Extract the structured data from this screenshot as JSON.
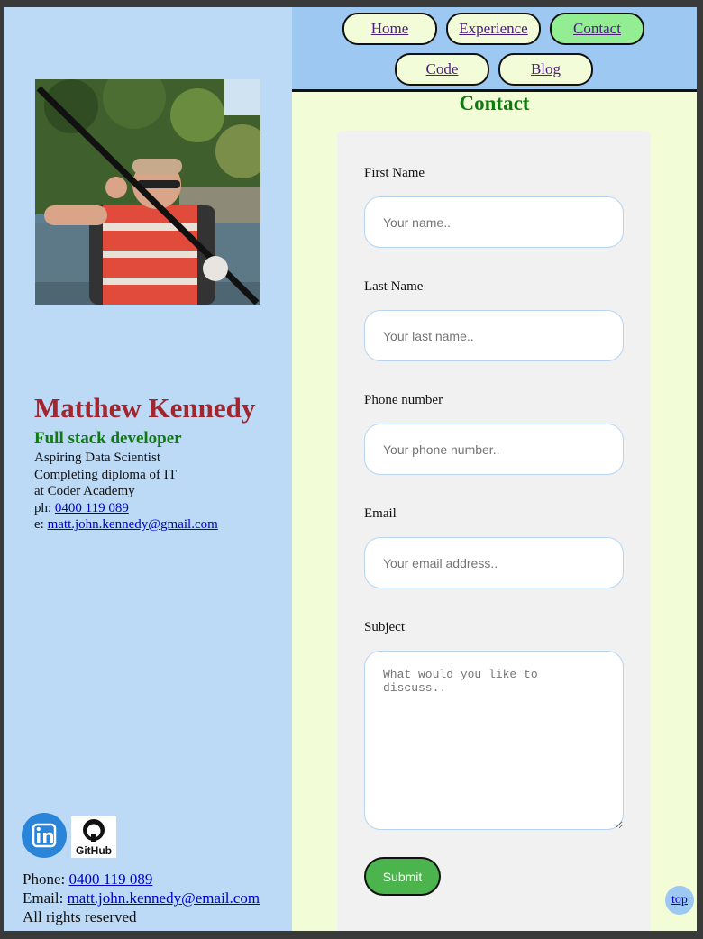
{
  "profile": {
    "name": "Matthew Kennedy",
    "role": "Full stack developer",
    "bio_lines": [
      "Aspiring Data Scientist",
      "Completing diploma of IT",
      "at Coder Academy"
    ],
    "phone_prefix": "ph: ",
    "phone": "0400 119 089",
    "email_prefix": "e: ",
    "email": "matt.john.kennedy@gmail.com"
  },
  "social": {
    "linkedin_icon": "linkedin-icon",
    "github_icon": "github-icon",
    "github_text": "GitHub"
  },
  "footer": {
    "phone_label": "Phone: ",
    "phone": "0400 119 089",
    "email_label": "Email: ",
    "email": "matt.john.kennedy@email.com",
    "rights": "All rights reserved"
  },
  "nav": {
    "items": [
      {
        "label": "Home"
      },
      {
        "label": "Experience"
      },
      {
        "label": "Contact",
        "active": true
      },
      {
        "label": "Code"
      },
      {
        "label": "Blog"
      }
    ]
  },
  "contact": {
    "title": "Contact",
    "first_name_label": "First Name",
    "first_name_placeholder": "Your name..",
    "last_name_label": "Last Name",
    "last_name_placeholder": "Your last name..",
    "phone_label": "Phone number",
    "phone_placeholder": "Your phone number..",
    "email_label": "Email",
    "email_placeholder": "Your email address..",
    "subject_label": "Subject",
    "subject_placeholder": "What would you like to discuss..",
    "submit_label": "Submit"
  },
  "top_link": "top",
  "colors": {
    "sidebar_bg": "#bcd9f5",
    "main_bg": "#f2fcd6",
    "nav_bg": "#9dc8f2",
    "active_tab": "#93ee93",
    "name_color": "#a3262e",
    "accent_green": "#0f7a0f",
    "submit_bg": "#4cb44c"
  }
}
